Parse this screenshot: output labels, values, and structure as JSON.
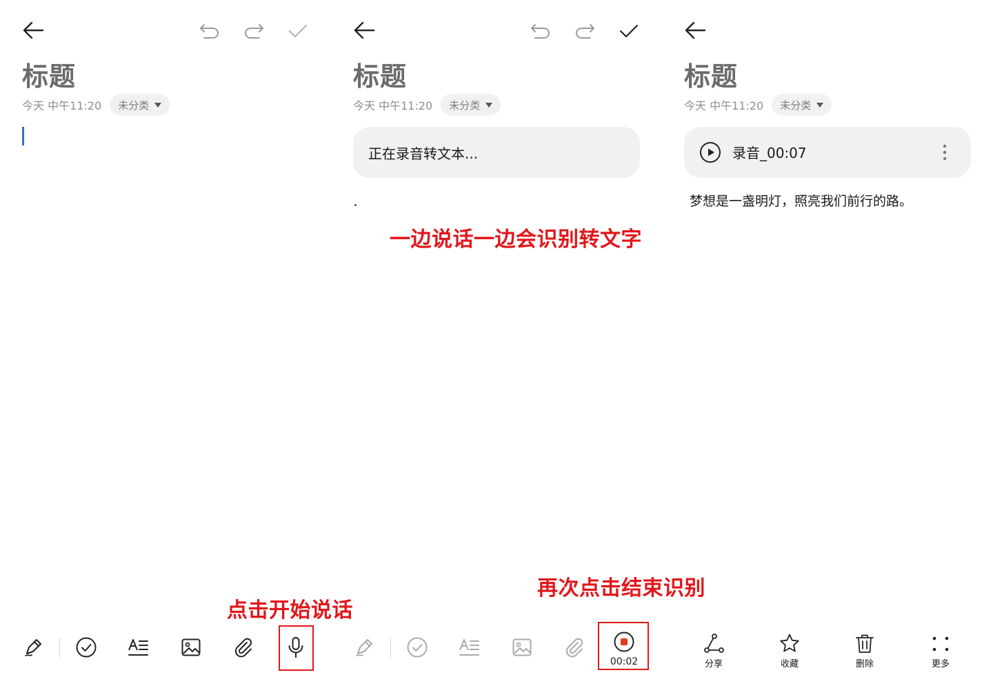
{
  "common": {
    "title": "标题",
    "date": "今天 中午11:20",
    "category": "未分类"
  },
  "panel2": {
    "status_text": "正在录音转文本...",
    "record_time": "00:02"
  },
  "panel3": {
    "audio_name": "录音_00:07",
    "transcript": "梦想是一盏明灯，照亮我们前行的路。",
    "actions": {
      "share": "分享",
      "favorite": "收藏",
      "delete": "删除",
      "more": "更多"
    }
  },
  "annotations": {
    "speak_while": "一边说话一边会识别转文字",
    "tap_start": "点击开始说话",
    "tap_end": "再次点击结束识别"
  },
  "colors": {
    "annotation_red": "#e2161a",
    "cursor_blue": "#2f6fdb",
    "stop_red": "#e8381f"
  },
  "icons": [
    "back-arrow-icon",
    "undo-icon",
    "redo-icon",
    "check-icon",
    "pen-icon",
    "checklist-icon",
    "text-format-icon",
    "image-icon",
    "paperclip-icon",
    "microphone-icon",
    "stop-icon",
    "play-icon",
    "more-vertical-icon",
    "share-icon",
    "star-icon",
    "trash-icon",
    "grid-more-icon"
  ]
}
